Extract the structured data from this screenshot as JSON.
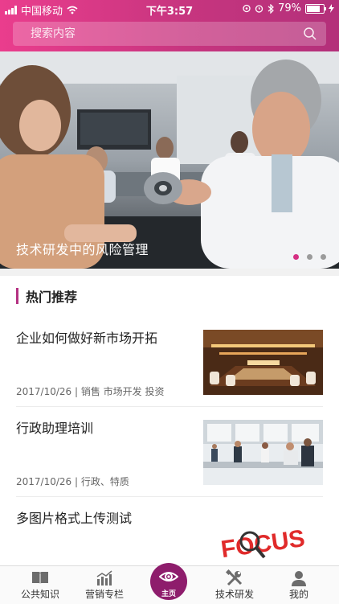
{
  "status_bar": {
    "carrier": "中国移动",
    "time": "下午3:57",
    "battery": "79%",
    "battery_level": 0.79
  },
  "search": {
    "placeholder": "搜索内容"
  },
  "banner": {
    "caption": "技术研发中的风险管理",
    "slide_count": 3,
    "active_slide": 1
  },
  "section": {
    "title": "热门推荐"
  },
  "articles": [
    {
      "title": "企业如何做好新市场开拓",
      "meta": "2017/10/26 | 销售 市场开发 投资"
    },
    {
      "title": "行政助理培训",
      "meta": "2017/10/26 | 行政、特质"
    },
    {
      "title": "多图片格式上传测试",
      "thumb_text": "FOCUS"
    }
  ],
  "tabs": [
    {
      "label": "公共知识",
      "icon": "book-icon"
    },
    {
      "label": "营销专栏",
      "icon": "chart-icon"
    },
    {
      "label": "主页",
      "icon": "eye-icon"
    },
    {
      "label": "技术研发",
      "icon": "tools-icon"
    },
    {
      "label": "我的",
      "icon": "person-icon"
    }
  ],
  "colors": {
    "brand": "#c7357f",
    "accent": "#b43182",
    "home": "#8e1d6c"
  }
}
